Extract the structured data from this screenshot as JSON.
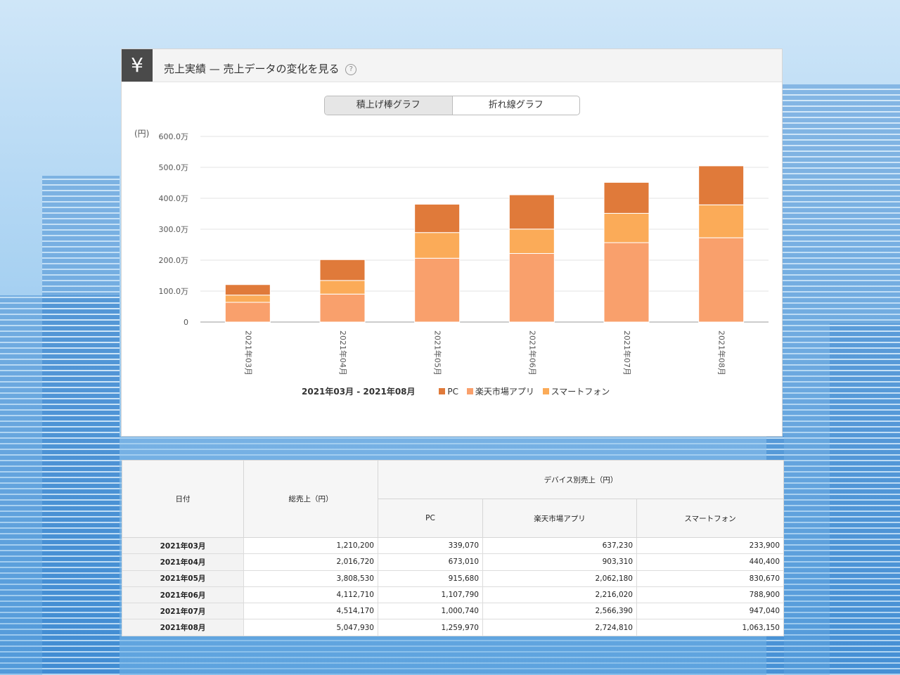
{
  "header": {
    "title": "売上実績 — 売上データの変化を見る",
    "icon": "yen-icon",
    "help": "?"
  },
  "toggle": {
    "stacked": "積上げ棒グラフ",
    "line": "折れ線グラフ"
  },
  "colors": {
    "pc": "#e07a3a",
    "rakuten": "#f9a06c",
    "smartphone": "#fbab58"
  },
  "chart_data": {
    "type": "bar",
    "stacked": true,
    "unit_label": "(円)",
    "categories": [
      "2021年03月",
      "2021年04月",
      "2021年05月",
      "2021年06月",
      "2021年07月",
      "2021年08月"
    ],
    "series": [
      {
        "name": "楽天市場アプリ",
        "values": [
          637230,
          903310,
          2062180,
          2216020,
          2566390,
          2724810
        ]
      },
      {
        "name": "スマートフォン",
        "values": [
          233900,
          440400,
          830670,
          788900,
          947040,
          1063150
        ]
      },
      {
        "name": "PC",
        "values": [
          339070,
          673010,
          915680,
          1107790,
          1000740,
          1259970
        ]
      }
    ],
    "ylim": [
      0,
      6000000
    ],
    "yticks": [
      "0",
      "100.0万",
      "200.0万",
      "300.0万",
      "400.0万",
      "500.0万",
      "600.0万"
    ],
    "grid": true,
    "legend": {
      "range": "2021年03月 - 2021年08月",
      "items": [
        "PC",
        "楽天市場アプリ",
        "スマートフォン"
      ],
      "placement": "bottom"
    }
  },
  "table": {
    "headers": {
      "date": "日付",
      "total": "総売上（円）",
      "group": "デバイス別売上（円）",
      "pc": "PC",
      "rakuten": "楽天市場アプリ",
      "smartphone": "スマートフォン"
    },
    "rows": [
      [
        "2021年03月",
        "1,210,200",
        "339,070",
        "637,230",
        "233,900"
      ],
      [
        "2021年04月",
        "2,016,720",
        "673,010",
        "903,310",
        "440,400"
      ],
      [
        "2021年05月",
        "3,808,530",
        "915,680",
        "2,062,180",
        "830,670"
      ],
      [
        "2021年06月",
        "4,112,710",
        "1,107,790",
        "2,216,020",
        "788,900"
      ],
      [
        "2021年07月",
        "4,514,170",
        "1,000,740",
        "2,566,390",
        "947,040"
      ],
      [
        "2021年08月",
        "5,047,930",
        "1,259,970",
        "2,724,810",
        "1,063,150"
      ]
    ]
  }
}
